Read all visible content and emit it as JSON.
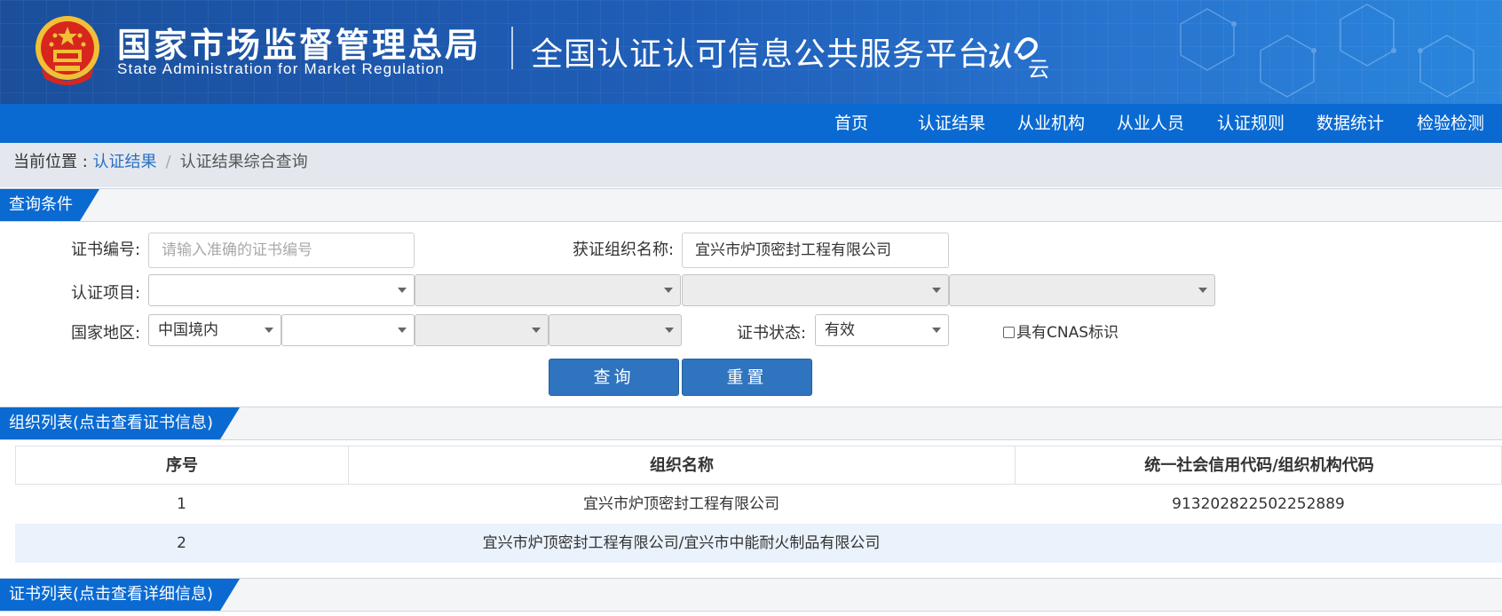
{
  "header": {
    "agency_cn": "国家市场监督管理总局",
    "agency_en": "State Administration  for  Market Regulation",
    "platform": "全国认证认可信息公共服务平台",
    "logo_text": "认e云",
    "emblem_icon": "national-emblem-icon"
  },
  "nav": {
    "items": [
      "首页",
      "认证结果",
      "从业机构",
      "从业人员",
      "认证规则",
      "数据统计",
      "检验检测"
    ]
  },
  "breadcrumb": {
    "prefix": "当前位置 : ",
    "link": "认证结果",
    "separator": "/",
    "current": "认证结果综合查询"
  },
  "query": {
    "section_title": "查询条件",
    "cert_no_label": "证书编号:",
    "cert_no_placeholder": "请输入准确的证书编号",
    "org_name_label": "获证组织名称:",
    "org_name_value": "宜兴市炉顶密封工程有限公司",
    "project_label": "认证项目:",
    "region_label": "国家地区:",
    "region_value": "中国境内",
    "status_label": "证书状态:",
    "status_value": "有效",
    "cnas_label": "具有CNAS标识",
    "search_button": "查询",
    "reset_button": "重置"
  },
  "org_list": {
    "section_title": "组织列表(点击查看证书信息)",
    "columns": [
      "序号",
      "组织名称",
      "统一社会信用代码/组织机构代码"
    ],
    "rows": [
      {
        "index": "1",
        "name": "宜兴市炉顶密封工程有限公司",
        "code": "913202822502252889"
      },
      {
        "index": "2",
        "name": "宜兴市炉顶密封工程有限公司/宜兴市中能耐火制品有限公司",
        "code": ""
      }
    ]
  },
  "cert_list": {
    "section_title": "证书列表(点击查看详细信息)"
  },
  "colors": {
    "nav_bg": "#0a6ad2",
    "button_bg": "#2f74bf",
    "link": "#2a6fc3",
    "row_alt": "#eaf2fc"
  }
}
